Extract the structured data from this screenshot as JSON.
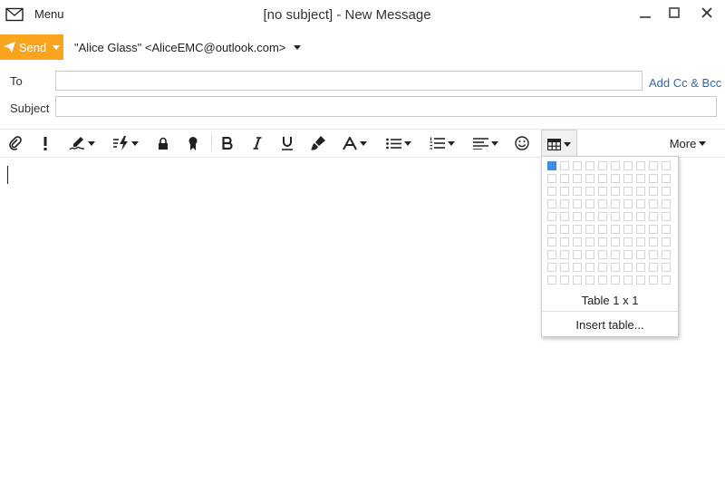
{
  "window": {
    "menu_label": "Menu",
    "title": "[no subject] - New Message"
  },
  "send": {
    "label": "Send",
    "from": "\"Alice Glass\" <AliceEMC@outlook.com>"
  },
  "fields": {
    "to_label": "To",
    "to_value": "",
    "subject_label": "Subject",
    "subject_value": "",
    "add_cc_bcc": "Add Cc & Bcc"
  },
  "toolbar": {
    "items": [
      "attach-icon",
      "importance-icon",
      "signature-icon",
      "quick-text-icon",
      "encrypt-icon",
      "sign-icon",
      "bold-icon",
      "italic-icon",
      "underline-icon",
      "format-painter-icon",
      "font-color-icon",
      "bullet-list-icon",
      "numbered-list-icon",
      "align-icon",
      "emoji-icon",
      "table-icon"
    ],
    "more_label": "More"
  },
  "table_popup": {
    "columns": 10,
    "rows": 10,
    "selected_columns": 1,
    "selected_rows": 1,
    "size_label": "Table 1 x 1",
    "insert_label": "Insert table...",
    "accent": "#3b8ee6"
  },
  "colors": {
    "send": "#f8a41c",
    "link": "#2e6ab4"
  }
}
